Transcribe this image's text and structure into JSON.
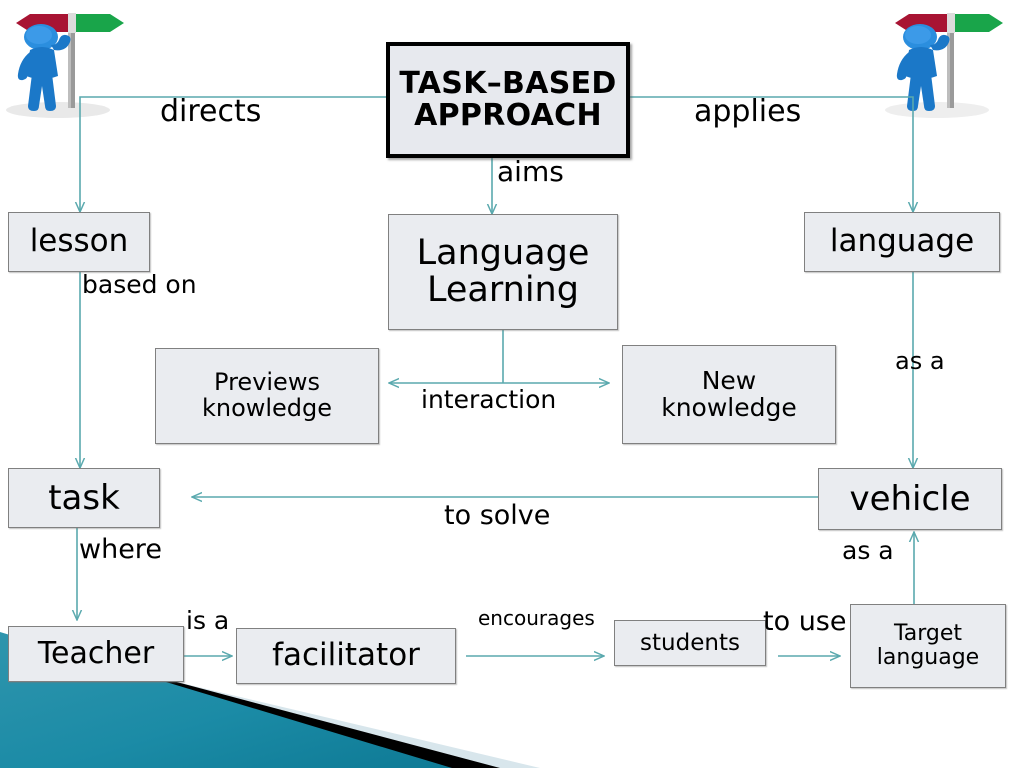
{
  "slide": {
    "title_node": "TASK–BASED\nAPPROACH",
    "title_line1": "TASK–BASED",
    "title_line2": "APPROACH"
  },
  "colors": {
    "arrow": "#5aa9ae",
    "node_fill": "#eaecf0",
    "node_border": "#808080",
    "title_border": "#000000",
    "banner_teal": "#1f8fa8",
    "banner_dark": "#000000",
    "banner_pale": "#d8e6ec",
    "figure_blue": "#1b78c8",
    "sign_red": "#a81433",
    "sign_green": "#19a54a",
    "post_gray": "#9a9a9a"
  },
  "nodes": [
    {
      "id": "title",
      "label": "TASK–BASED APPROACH"
    },
    {
      "id": "lesson",
      "label": "lesson"
    },
    {
      "id": "language_learning",
      "label": "Language Learning"
    },
    {
      "id": "language",
      "label": "language"
    },
    {
      "id": "previews",
      "label": "Previews knowledge"
    },
    {
      "id": "new_knowledge",
      "label": "New knowledge"
    },
    {
      "id": "task",
      "label": "task"
    },
    {
      "id": "vehicle",
      "label": "vehicle"
    },
    {
      "id": "teacher",
      "label": "Teacher"
    },
    {
      "id": "facilitator",
      "label": "facilitator"
    },
    {
      "id": "students",
      "label": "students"
    },
    {
      "id": "target_language",
      "label": "Target language"
    }
  ],
  "node_text": {
    "lesson": "lesson",
    "language_learning_l1": "Language",
    "language_learning_l2": "Learning",
    "language": "language",
    "previews_l1": "Previews",
    "previews_l2": "knowledge",
    "new_l1": "New",
    "new_l2": "knowledge",
    "task": "task",
    "vehicle": "vehicle",
    "teacher": "Teacher",
    "facilitator": "facilitator",
    "students": "students",
    "target_l1": "Target",
    "target_l2": "language"
  },
  "edge_labels": {
    "directs": "directs",
    "applies": "applies",
    "aims": "aims",
    "based_on": "based on",
    "interaction": "interaction",
    "as_a_right": "as a",
    "to_solve": "to solve",
    "where": "where",
    "as_a_bottom": "as a",
    "is_a": "is a",
    "encourages": "encourages",
    "to_use": "to use"
  },
  "icons": {
    "left_signpost": "signpost-person-icon",
    "right_signpost": "signpost-person-icon",
    "corner_banner": "corner-banner-decoration"
  }
}
